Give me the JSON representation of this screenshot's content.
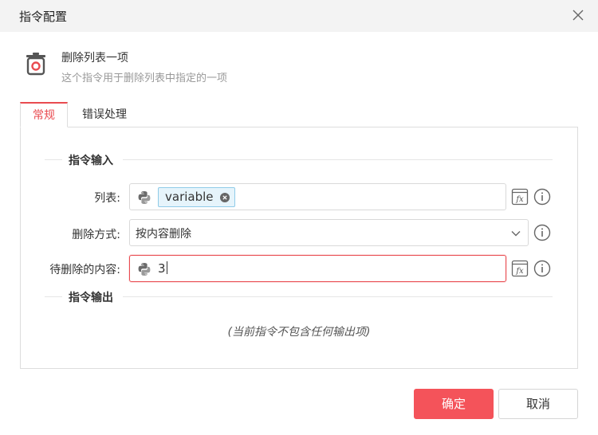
{
  "dialog": {
    "title": "指令配置",
    "close_icon": "close-icon"
  },
  "command": {
    "name": "删除列表一项",
    "description": "这个指令用于删除列表中指定的一项",
    "icon": "trash-icon",
    "accent_color": "#e94b50"
  },
  "tabs": [
    {
      "label": "常规",
      "active": true
    },
    {
      "label": "错误处理",
      "active": false
    }
  ],
  "inputs_section": {
    "title": "指令输入"
  },
  "fields": {
    "list": {
      "label": "列表:",
      "variable_chip": "variable"
    },
    "delete_mode": {
      "label": "删除方式:",
      "selected": "按内容删除"
    },
    "content": {
      "label": "待删除的内容:",
      "value": "3"
    }
  },
  "outputs_section": {
    "title": "指令输出",
    "empty_text": "(当前指令不包含任何输出项)"
  },
  "buttons": {
    "ok": "确定",
    "cancel": "取消"
  },
  "colors": {
    "primary_button": "#f4535a",
    "chip_bg": "#e6f4fb",
    "chip_border": "#8fcbe8"
  }
}
